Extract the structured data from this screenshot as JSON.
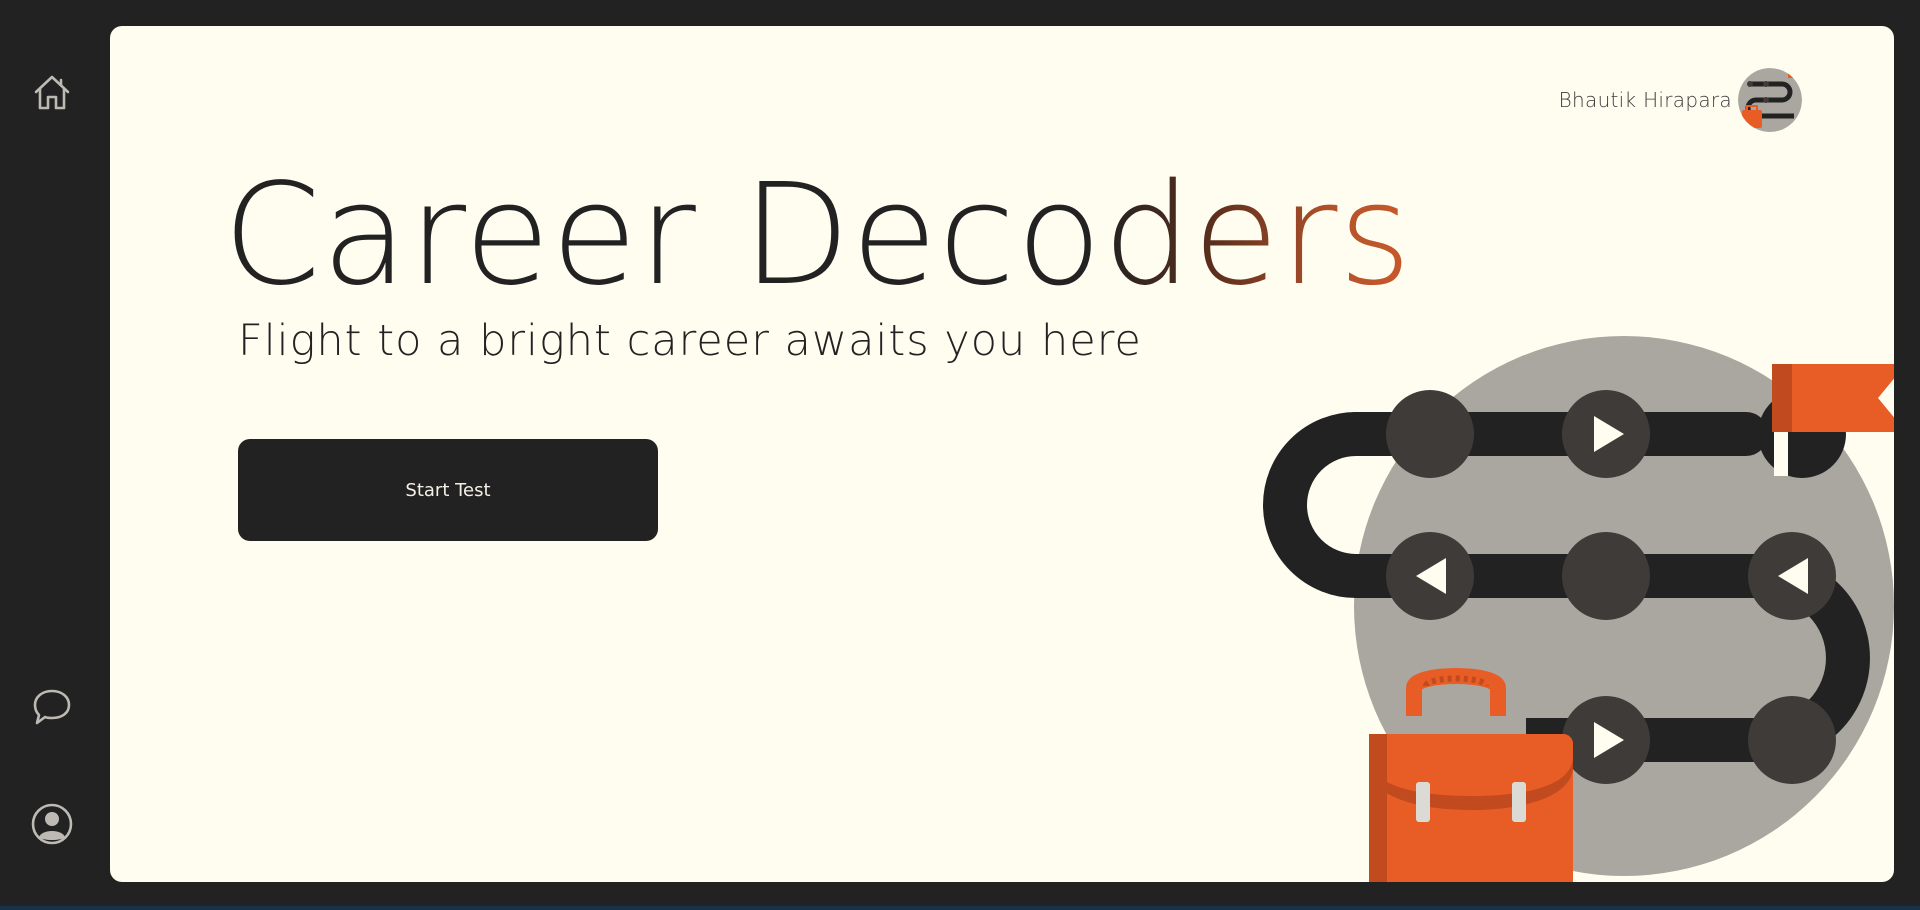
{
  "sidebar": {
    "items": [
      {
        "icon": "home-icon"
      },
      {
        "icon": "chat-icon"
      },
      {
        "icon": "user-profile-icon"
      }
    ]
  },
  "user": {
    "name": "Bhautik Hirapara"
  },
  "hero": {
    "title_plain": "Career Deco",
    "title_accent": "ders",
    "subtitle": "Flight to a bright career awaits you here",
    "start_button": "Start Test"
  },
  "colors": {
    "dark": "#232222",
    "cream": "#fffcf0",
    "accent": "#e85d26",
    "accent_dark": "#c24a1f",
    "circle_gray": "#aaa7a0",
    "node": "#3f3b38"
  }
}
